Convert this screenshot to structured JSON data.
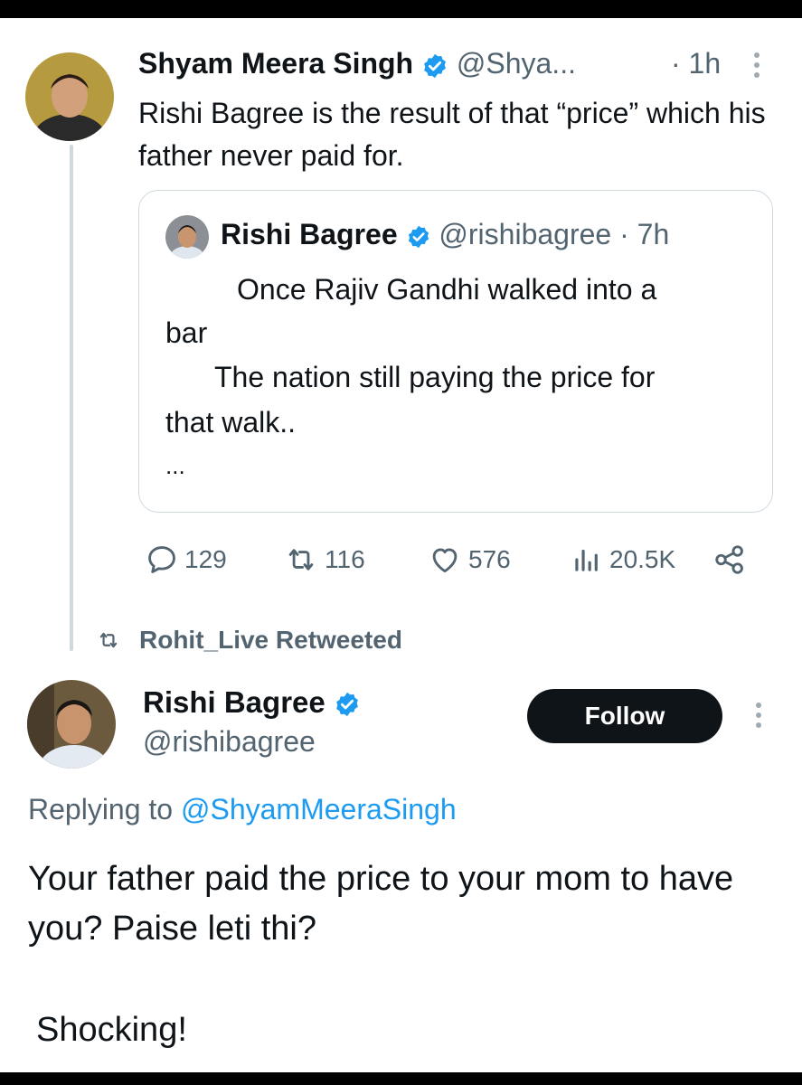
{
  "tweet1": {
    "name": "Shyam Meera Singh",
    "handle": "@Shya...",
    "time": "· 1h",
    "text": "Rishi Bagree is the result of that “price” which his father never paid for."
  },
  "quote": {
    "name": "Rishi Bagree",
    "handle": "@rishibagree · 7h",
    "lines": [
      "Once Rajiv Gandhi walked into a",
      "bar",
      "The nation still paying the price for",
      "that walk..",
      "..."
    ]
  },
  "actions": {
    "replies": "129",
    "retweets": "116",
    "likes": "576",
    "views": "20.5K"
  },
  "retweet_bar": {
    "label": "Rohit_Live Retweeted"
  },
  "tweet2": {
    "name": "Rishi Bagree",
    "handle": "@rishibagree",
    "follow_label": "Follow",
    "replying_prefix": "Replying to",
    "replying_to": "@ShyamMeeraSingh",
    "text": "Your father paid the price to your mom to have you? Paise leti thi?",
    "text2": "Shocking!"
  },
  "colors": {
    "accent": "#1d9bf0",
    "muted": "#536471",
    "border": "#cfd9de",
    "follow_bg": "#0f1419"
  },
  "icons": [
    "verified-badge-icon",
    "more-icon",
    "reply-icon",
    "retweet-icon",
    "like-icon",
    "views-icon",
    "share-icon"
  ]
}
